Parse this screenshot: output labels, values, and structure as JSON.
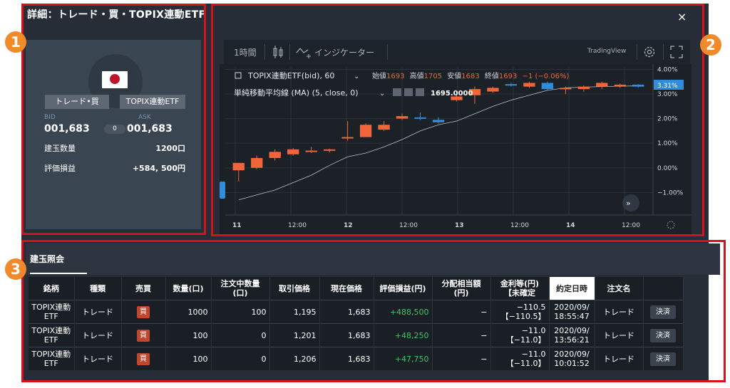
{
  "window": {
    "title": "詳細：トレード・買・TOPIX連動ETF",
    "close": "×"
  },
  "annotations": {
    "n1": "1",
    "n2": "2",
    "n3": "3"
  },
  "left": {
    "tag_side": "トレード•買",
    "tag_name": "TOPIX連動ETF",
    "bid_label": "BID",
    "ask_label": "ASK",
    "bid": "001,683",
    "ask": "001,683",
    "spread": "0",
    "qty_label": "建玉数量",
    "qty": "1200口",
    "pl_label": "評価損益",
    "pl": "+584, 500円"
  },
  "chart_toolbar": {
    "interval": "1時間",
    "indicator": "インジケーター",
    "brand": "TradingView"
  },
  "chart_data": {
    "type": "candlestick",
    "symbol_line": "TOPIX連動ETF(bid), 60",
    "ohlc_labels": {
      "open_label": "始値",
      "open": "1693",
      "high_label": "高値",
      "high": "1705",
      "low_label": "安値",
      "low": "1683",
      "close_label": "終値",
      "close": "1693",
      "change": "−1 (−0.06%)"
    },
    "ma_label": "単純移動平均線 (MA) (5, close, 0)",
    "ma_value": "1695.0000",
    "y_ticks": [
      "4.00%",
      "3.00%",
      "2.00%",
      "1.00%",
      "0.00%",
      "−1.00%"
    ],
    "y_tick_values": [
      4,
      3,
      2,
      1,
      0,
      -1
    ],
    "ylim": [
      -1.8,
      4.1
    ],
    "last_value_label": "3.31%",
    "last_value": 3.31,
    "x_ticks": [
      "11",
      "12:00",
      "12",
      "12:00",
      "13",
      "12:00",
      "14",
      "12:00"
    ],
    "candles": [
      {
        "o": -0.1,
        "h": 0.1,
        "l": -0.55,
        "c": 0.2
      },
      {
        "o": 0.0,
        "h": 0.5,
        "l": -0.05,
        "c": 0.4
      },
      {
        "o": 0.4,
        "h": 0.75,
        "l": 0.3,
        "c": 0.65
      },
      {
        "o": 0.55,
        "h": 0.8,
        "l": 0.5,
        "c": 0.75
      },
      {
        "o": 0.65,
        "h": 0.85,
        "l": 0.6,
        "c": 0.7
      },
      {
        "o": 0.7,
        "h": 0.78,
        "l": 0.62,
        "c": 0.75
      },
      {
        "o": 1.2,
        "h": 1.9,
        "l": 1.1,
        "c": 1.25
      },
      {
        "o": 1.25,
        "h": 1.8,
        "l": 1.25,
        "c": 1.75
      },
      {
        "o": 1.55,
        "h": 1.9,
        "l": 1.5,
        "c": 1.75
      },
      {
        "o": 2.0,
        "h": 2.2,
        "l": 1.95,
        "c": 2.1
      },
      {
        "o": 2.05,
        "h": 2.25,
        "l": 1.95,
        "c": 2.0
      },
      {
        "o": 1.95,
        "h": 2.05,
        "l": 1.8,
        "c": 1.85
      },
      {
        "o": 2.75,
        "h": 3.0,
        "l": 2.7,
        "c": 2.9
      },
      {
        "o": 2.95,
        "h": 3.3,
        "l": 2.6,
        "c": 3.2
      },
      {
        "o": 3.1,
        "h": 3.3,
        "l": 3.05,
        "c": 3.25
      },
      {
        "o": 3.4,
        "h": 3.45,
        "l": 3.3,
        "c": 3.35
      },
      {
        "o": 3.3,
        "h": 3.5,
        "l": 3.25,
        "c": 3.45
      },
      {
        "o": 3.45,
        "h": 3.5,
        "l": 3.15,
        "c": 3.2
      },
      {
        "o": 3.2,
        "h": 3.3,
        "l": 3.0,
        "c": 3.25
      },
      {
        "o": 3.2,
        "h": 3.35,
        "l": 3.1,
        "c": 3.3
      },
      {
        "o": 3.3,
        "h": 3.5,
        "l": 3.2,
        "c": 3.45
      },
      {
        "o": 3.3,
        "h": 3.42,
        "l": 3.25,
        "c": 3.38
      },
      {
        "o": 3.38,
        "h": 3.4,
        "l": 3.25,
        "c": 3.3
      }
    ],
    "ma": [
      -1.3,
      -1.1,
      -0.9,
      -0.6,
      -0.3,
      0.1,
      0.45,
      0.6,
      0.85,
      1.15,
      1.5,
      1.75,
      1.9,
      2.2,
      2.5,
      2.75,
      2.95,
      3.15,
      3.25,
      3.28,
      3.3,
      3.32,
      3.33
    ]
  },
  "table": {
    "tab": "建玉照会",
    "headers": [
      "銘柄",
      "種類",
      "売買",
      "数量(口)",
      "注文中数量(口)",
      "取引価格",
      "現在価格",
      "評価損益(円)",
      "分配相当額(円)",
      "金利等(円)【未確定",
      "約定日時",
      "注文名",
      ""
    ],
    "rows": [
      {
        "name": "TOPIX連動ETF",
        "kind": "トレード",
        "side": "買",
        "qty": "1000",
        "pending": "100",
        "price": "1,195",
        "current": "1,683",
        "pl": "+488,500",
        "dist": "−",
        "interest": "−110.5",
        "interest2": "【−110.5】",
        "date": "2020/09/",
        "time": "18:55:47",
        "order": "トレード",
        "action": "決済"
      },
      {
        "name": "TOPIX連動ETF",
        "kind": "トレード",
        "side": "買",
        "qty": "100",
        "pending": "0",
        "price": "1,201",
        "current": "1,683",
        "pl": "+48,250",
        "dist": "−",
        "interest": "−11.0",
        "interest2": "【−11.0】",
        "date": "2020/09/",
        "time": "13:56:21",
        "order": "トレード",
        "action": "決済"
      },
      {
        "name": "TOPIX連動ETF",
        "kind": "トレード",
        "side": "買",
        "qty": "100",
        "pending": "0",
        "price": "1,206",
        "current": "1,683",
        "pl": "+47,750",
        "dist": "−",
        "interest": "−11.0",
        "interest2": "【−11.0】",
        "date": "2020/09/",
        "time": "10:01:52",
        "order": "トレード",
        "action": "決済"
      }
    ]
  },
  "colors": {
    "up": "#f0663a",
    "down": "#2f8ddb",
    "ma": "#b9bfc6",
    "grid": "#2a313a"
  }
}
